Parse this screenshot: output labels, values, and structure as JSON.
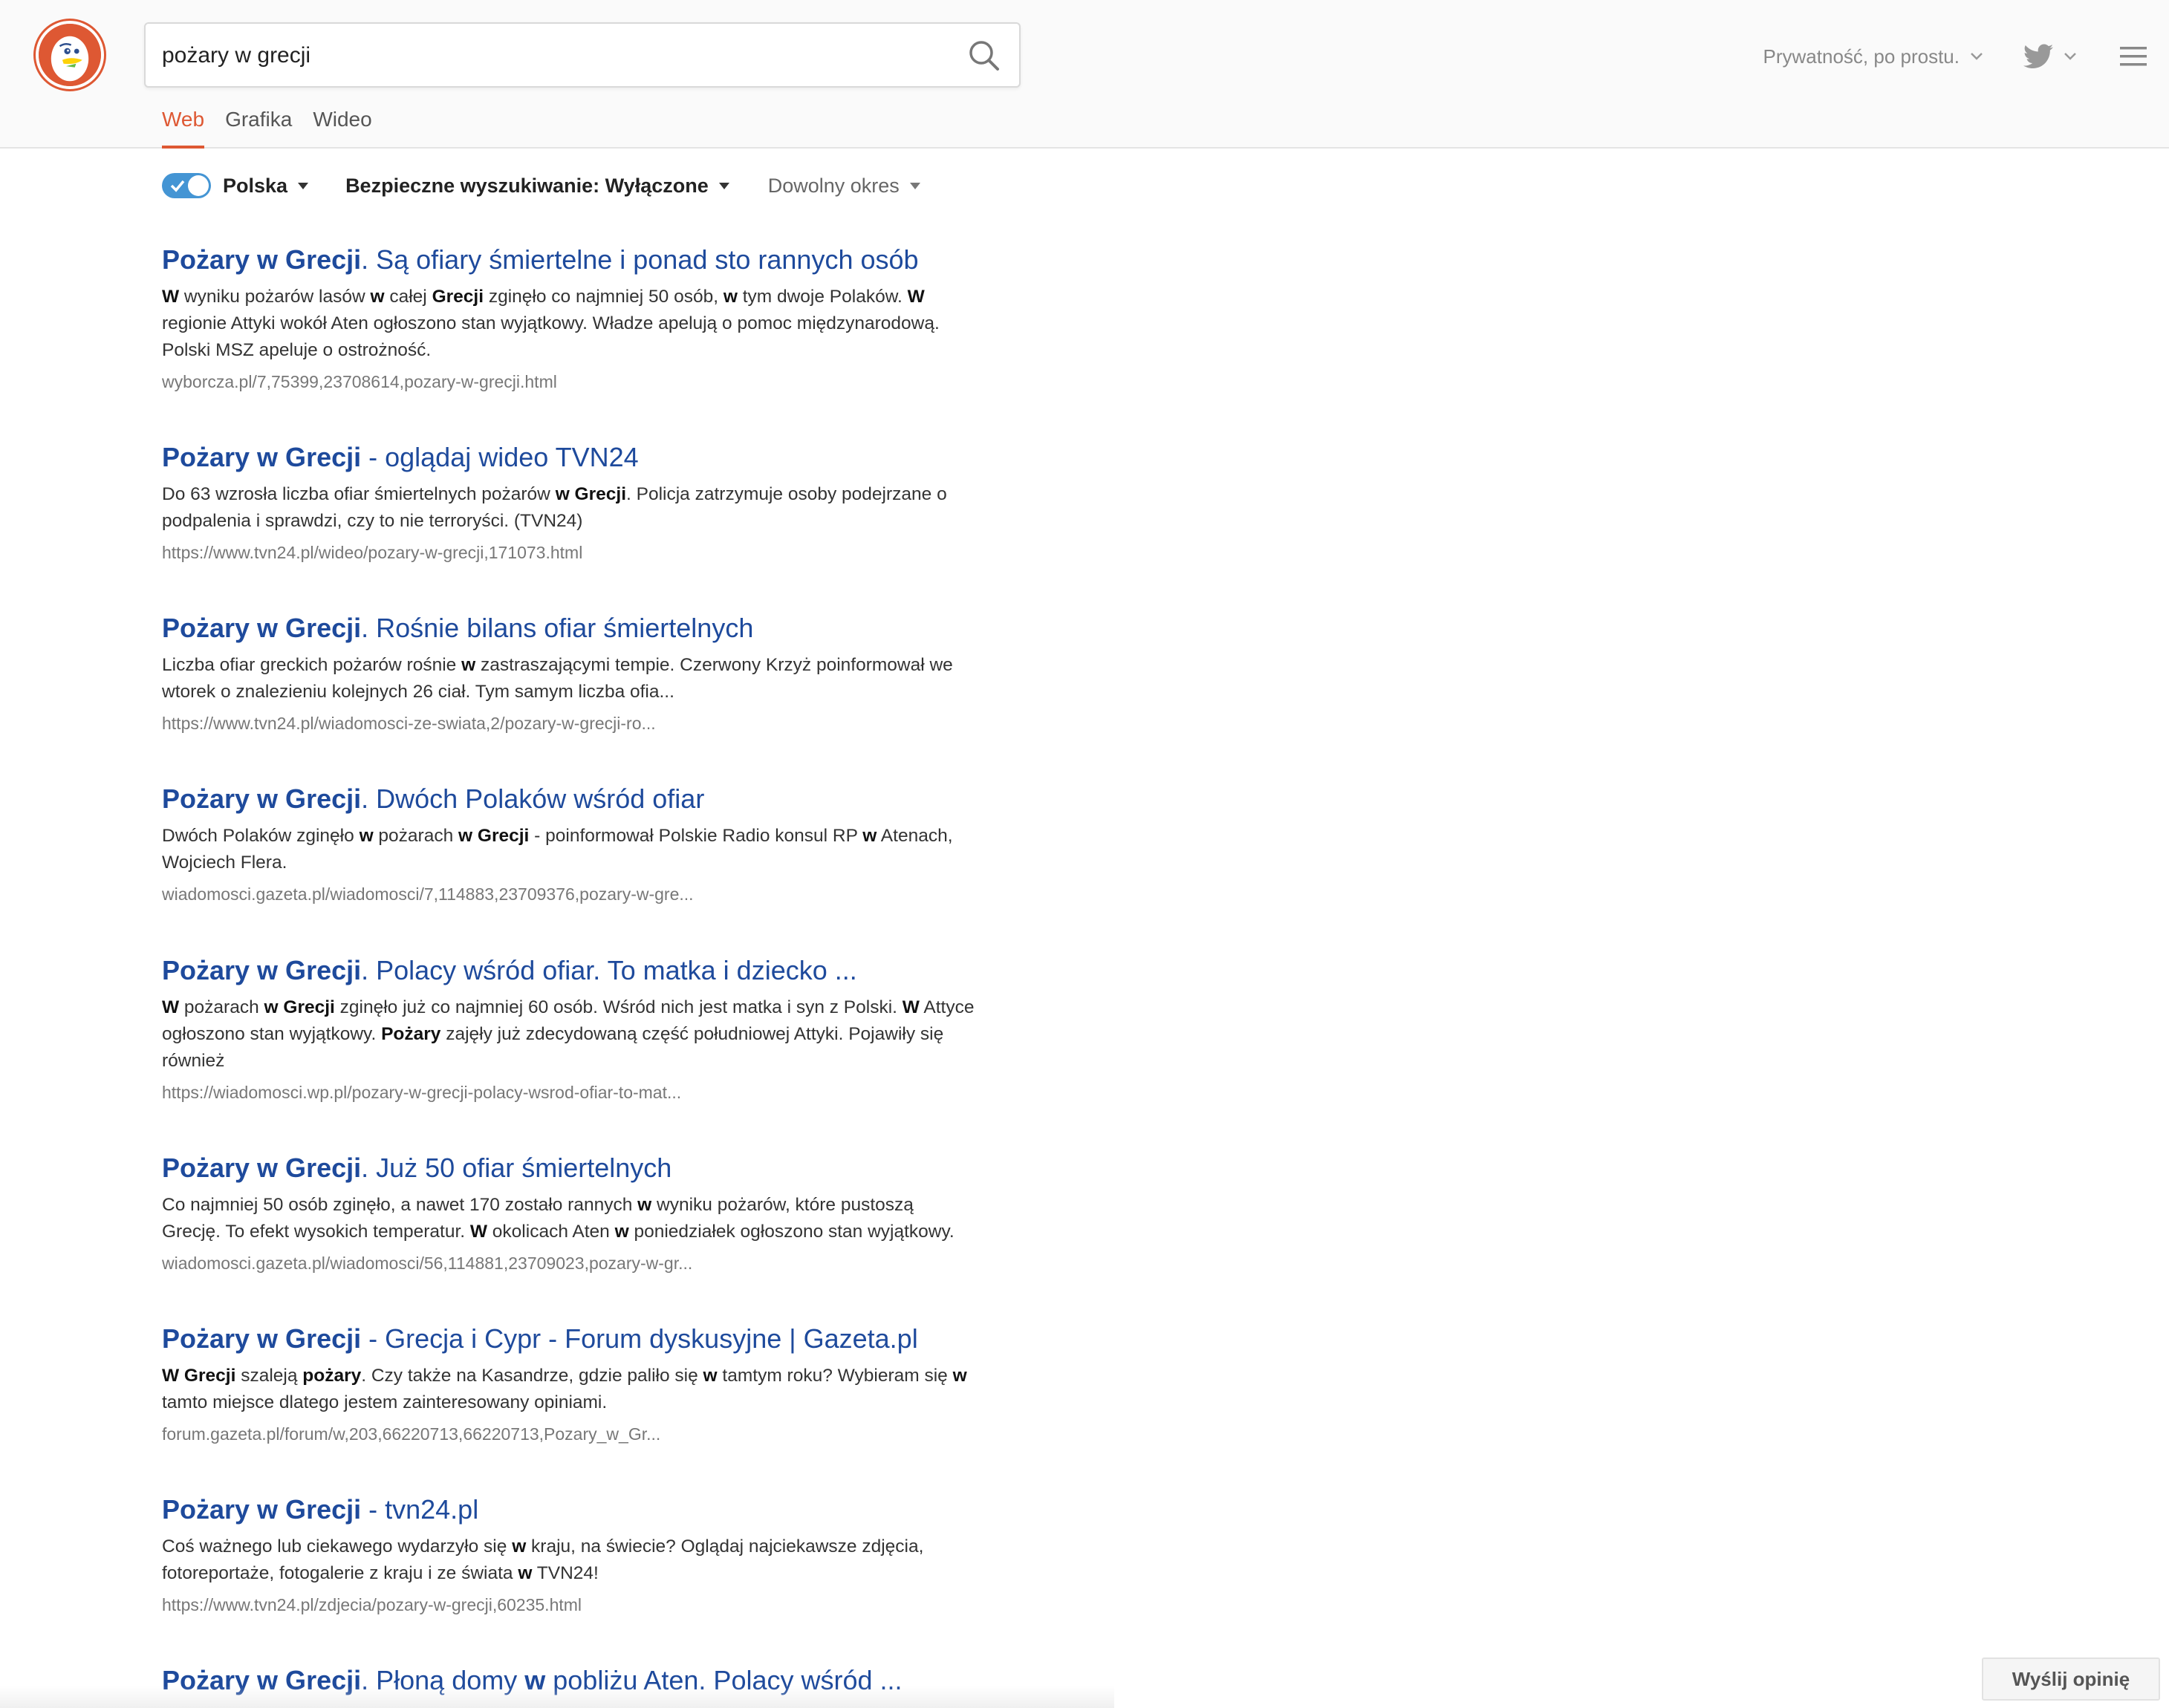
{
  "search": {
    "query": "pożary w grecji"
  },
  "tabs": [
    {
      "label": "Web",
      "active": true
    },
    {
      "label": "Grafika",
      "active": false
    },
    {
      "label": "Wideo",
      "active": false
    }
  ],
  "header": {
    "privacy_label": "Prywatność, po prostu."
  },
  "filters": {
    "region_enabled": true,
    "region_label": "Polska",
    "safe_search_label": "Bezpieczne wyszukiwanie: Wyłączone",
    "time_label": "Dowolny okres"
  },
  "results": [
    {
      "title_bold": "Pożary w Grecji",
      "title_rest": ". Są ofiary śmiertelne i ponad sto rannych osób",
      "snippet": [
        [
          {
            "t": "W",
            "b": true
          },
          {
            "t": " wyniku pożarów lasów "
          },
          {
            "t": "w",
            "b": true
          },
          {
            "t": " całej "
          },
          {
            "t": "Grecji",
            "b": true
          },
          {
            "t": " zginęło co najmniej 50 osób, "
          },
          {
            "t": "w",
            "b": true
          },
          {
            "t": " tym dwoje Polaków. "
          },
          {
            "t": "W",
            "b": true
          }
        ],
        [
          {
            "t": "regionie Attyki wokół Aten ogłoszono stan wyjątkowy. Władze apelują o pomoc międzynarodową."
          }
        ],
        [
          {
            "t": "Polski MSZ apeluje o ostrożność."
          }
        ]
      ],
      "url": "wyborcza.pl/7,75399,23708614,pozary-w-grecji.html"
    },
    {
      "title_bold": "Pożary w Grecji",
      "title_rest": " - oglądaj wideo TVN24",
      "snippet": [
        [
          {
            "t": "Do 63 wzrosła liczba ofiar śmiertelnych pożarów "
          },
          {
            "t": "w Grecji",
            "b": true
          },
          {
            "t": ". Policja zatrzymuje osoby podejrzane o"
          }
        ],
        [
          {
            "t": "podpalenia i sprawdzi, czy to nie terroryści. (TVN24)"
          }
        ]
      ],
      "url": "https://www.tvn24.pl/wideo/pozary-w-grecji,171073.html"
    },
    {
      "title_bold": "Pożary w Grecji",
      "title_rest": ". Rośnie bilans ofiar śmiertelnych",
      "snippet": [
        [
          {
            "t": "Liczba ofiar greckich pożarów rośnie "
          },
          {
            "t": "w",
            "b": true
          },
          {
            "t": " zastraszającymi tempie. Czerwony Krzyż poinformował we"
          }
        ],
        [
          {
            "t": "wtorek o znalezieniu kolejnych 26 ciał. Tym samym liczba ofia..."
          }
        ]
      ],
      "url": "https://www.tvn24.pl/wiadomosci-ze-swiata,2/pozary-w-grecji-ro..."
    },
    {
      "title_bold": "Pożary w Grecji",
      "title_rest": ". Dwóch Polaków wśród ofiar",
      "snippet": [
        [
          {
            "t": "Dwóch Polaków zginęło "
          },
          {
            "t": "w",
            "b": true
          },
          {
            "t": " pożarach "
          },
          {
            "t": "w Grecji",
            "b": true
          },
          {
            "t": " - poinformował Polskie Radio konsul RP "
          },
          {
            "t": "w",
            "b": true
          },
          {
            "t": " Atenach,"
          }
        ],
        [
          {
            "t": "Wojciech Flera."
          }
        ]
      ],
      "url": "wiadomosci.gazeta.pl/wiadomosci/7,114883,23709376,pozary-w-gre..."
    },
    {
      "title_bold": "Pożary w Grecji",
      "title_rest": ". Polacy wśród ofiar. To matka i dziecko ...",
      "snippet": [
        [
          {
            "t": "W",
            "b": true
          },
          {
            "t": " pożarach "
          },
          {
            "t": "w Grecji",
            "b": true
          },
          {
            "t": " zginęło już co najmniej 60 osób. Wśród nich jest matka i syn z Polski. "
          },
          {
            "t": "W",
            "b": true
          },
          {
            "t": " Attyce"
          }
        ],
        [
          {
            "t": "ogłoszono stan wyjątkowy. "
          },
          {
            "t": "Pożary",
            "b": true
          },
          {
            "t": " zajęły już zdecydowaną część południowej Attyki. Pojawiły się"
          }
        ],
        [
          {
            "t": "również"
          }
        ]
      ],
      "url": "https://wiadomosci.wp.pl/pozary-w-grecji-polacy-wsrod-ofiar-to-mat..."
    },
    {
      "title_bold": "Pożary w Grecji",
      "title_rest": ". Już 50 ofiar śmiertelnych",
      "snippet": [
        [
          {
            "t": "Co najmniej 50 osób zginęło, a nawet 170 zostało rannych "
          },
          {
            "t": "w",
            "b": true
          },
          {
            "t": " wyniku pożarów, które pustoszą"
          }
        ],
        [
          {
            "t": "Grecję. To efekt wysokich temperatur. "
          },
          {
            "t": "W",
            "b": true
          },
          {
            "t": " okolicach Aten "
          },
          {
            "t": "w",
            "b": true
          },
          {
            "t": " poniedziałek ogłoszono stan wyjątkowy."
          }
        ]
      ],
      "url": "wiadomosci.gazeta.pl/wiadomosci/56,114881,23709023,pozary-w-gr..."
    },
    {
      "title_bold": "Pożary w Grecji",
      "title_rest": " - Grecja i Cypr - Forum dyskusyjne | Gazeta.pl",
      "snippet": [
        [
          {
            "t": "W Grecji",
            "b": true
          },
          {
            "t": " szaleją "
          },
          {
            "t": "pożary",
            "b": true
          },
          {
            "t": ". Czy także na Kasandrze, gdzie paliło się "
          },
          {
            "t": "w",
            "b": true
          },
          {
            "t": " tamtym roku? Wybieram się "
          },
          {
            "t": "w",
            "b": true
          }
        ],
        [
          {
            "t": "tamto miejsce dlatego jestem zainteresowany opiniami."
          }
        ]
      ],
      "url": "forum.gazeta.pl/forum/w,203,66220713,66220713,Pozary_w_Gr..."
    },
    {
      "title_bold": "Pożary w Grecji",
      "title_rest": " - tvn24.pl",
      "snippet": [
        [
          {
            "t": "Coś ważnego lub ciekawego wydarzyło się "
          },
          {
            "t": "w",
            "b": true
          },
          {
            "t": " kraju, na świecie? Oglądaj najciekawsze zdjęcia,"
          }
        ],
        [
          {
            "t": "fotoreportaże, fotogalerie z kraju i ze świata "
          },
          {
            "t": "w",
            "b": true
          },
          {
            "t": " TVN24!"
          }
        ]
      ],
      "url": "https://www.tvn24.pl/zdjecia/pozary-w-grecji,60235.html"
    },
    {
      "title_bold": "Pożary w Grecji",
      "title_rest": ". Płoną domy ",
      "title_bold2": "w",
      "title_rest2": " pobliżu Aten. Polacy wśród ...",
      "snippet": [],
      "url": ""
    }
  ],
  "feedback_label": "Wyślij opinię",
  "colors": {
    "accent": "#de5833",
    "link": "#1e4a9c",
    "toggle": "#4495d4"
  }
}
